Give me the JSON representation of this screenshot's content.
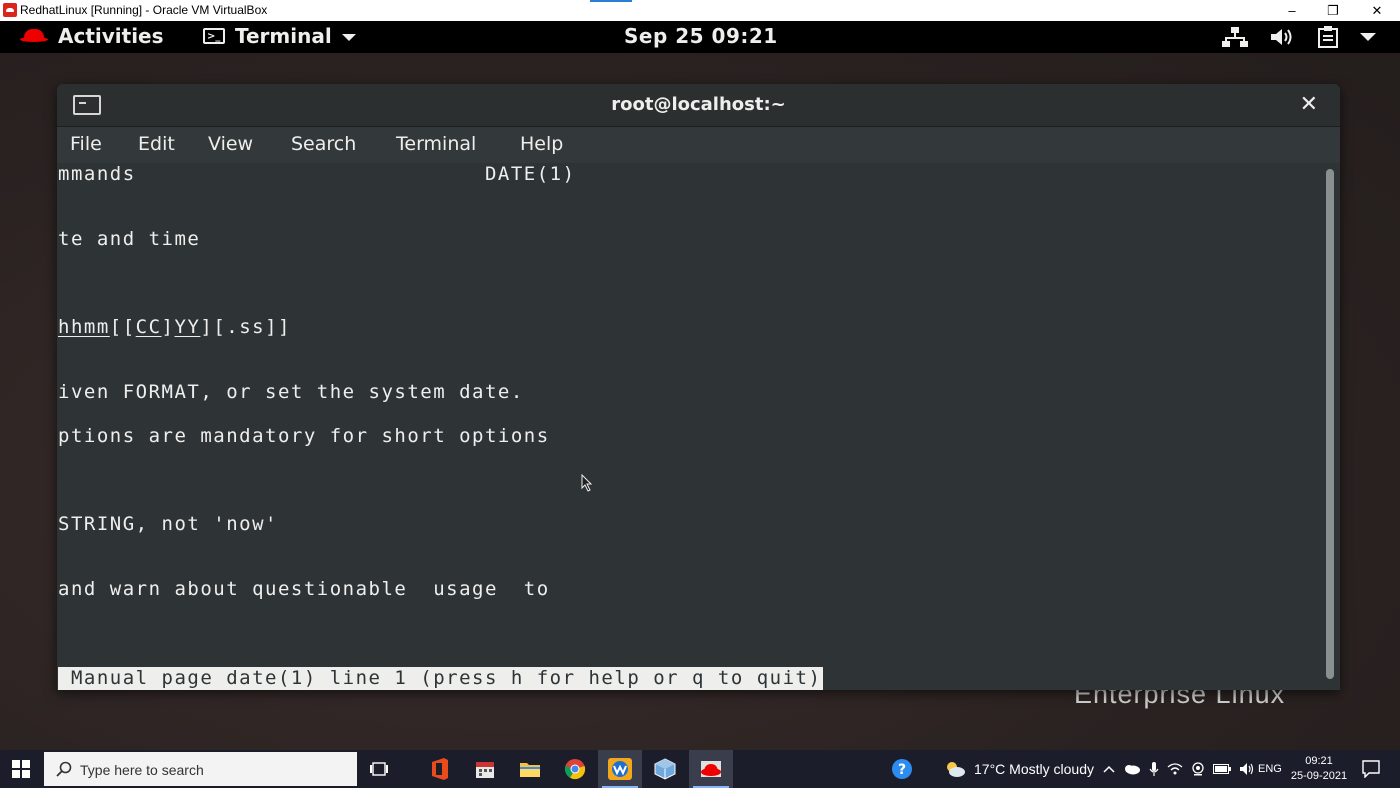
{
  "host_window": {
    "title": "RedhatLinux [Running] - Oracle VM VirtualBox",
    "minimize_glyph": "–",
    "restore_glyph": "❐",
    "close_glyph": "✕"
  },
  "gnome_topbar": {
    "activities_label": "Activities",
    "app_menu_label": "Terminal",
    "clock": "Sep 25  09:21"
  },
  "desktop": {
    "background_text": "Enterprise Linux"
  },
  "terminal": {
    "title": "root@localhost:~",
    "close_glyph": "✕",
    "menu": [
      "File",
      "Edit",
      "View",
      "Search",
      "Terminal",
      "Help"
    ],
    "lines": [
      "mmands                           DATE(1)",
      "te and time",
      "[.ss]]",
      "iven FORMAT, or set the system date.",
      "ptions are mandatory for short options",
      "STRING, not 'now'",
      "and warn about questionable  usage  to"
    ],
    "synopsis_parts": [
      "hhmm",
      "[[",
      "CC",
      "]",
      "YY",
      "]"
    ],
    "status_line": " Manual page date(1) line 1 (press h for help or q to quit)"
  },
  "taskbar": {
    "search_placeholder": "Type here to search",
    "weather": "17°C  Mostly cloudy",
    "language": "ENG",
    "time": "09:21",
    "date": "25-09-2021"
  },
  "colors": {
    "terminal_bg": "#2e3436",
    "terminal_fg": "#eeeeec",
    "topbar_bg": "#000000",
    "taskbar_bg": "#1b1d2a",
    "accent_red": "#ee0000"
  }
}
